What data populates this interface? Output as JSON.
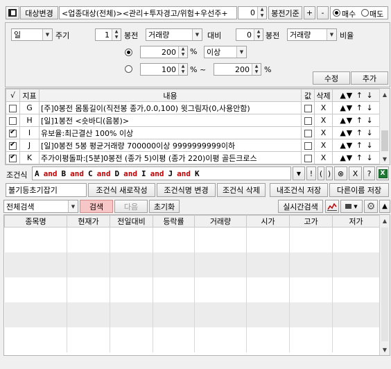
{
  "toolbar": {
    "target_label": "대상변경",
    "target_value": "<업종대상(전체)><관리+투자경고/위험+우선주+",
    "bar_value": "0",
    "bar_basis_label": "봉전기준",
    "plus": "+",
    "minus": "-",
    "buy_label": "매수",
    "sell_label": "매도"
  },
  "settings": {
    "period_value": "일",
    "period_label": "주기",
    "bar1_value": "1",
    "bar1_label": "봉전",
    "metric1_value": "거래량",
    "compare_label": "대비",
    "bar2_value": "0",
    "bar2_label": "봉전",
    "metric2_value": "거래량",
    "ratio_label": "비율",
    "opt1_value": "200",
    "opt1_unit": "%",
    "opt1_cond": "이상",
    "opt2_from": "100",
    "opt2_sep": "% ~",
    "opt2_to": "200",
    "opt2_unit": "%",
    "edit_label": "수정",
    "add_label": "추가"
  },
  "conditions": {
    "headers": {
      "check": "√",
      "index": "지표",
      "content": "내용",
      "value": "값",
      "delete": "삭제"
    },
    "move_labels": {
      "top": "▲",
      "up": "▼",
      "up2": "↑",
      "down": "↓"
    },
    "delete_glyph": "X",
    "rows": [
      {
        "checked": false,
        "index": "G",
        "content": "[주]0봉전 몸통길이(직전봉 종가,0.0,100) 윗그림자(0,사용안함)"
      },
      {
        "checked": false,
        "index": "H",
        "content": "[일]1봉전 <숏바디(음봉)>"
      },
      {
        "checked": true,
        "index": "I",
        "content": "유보율:최근결산 100% 이상"
      },
      {
        "checked": true,
        "index": "J",
        "content": "[일]0봉전 5봉 평균거래량 700000이상 9999999999이하"
      },
      {
        "checked": true,
        "index": "K",
        "content": "주가이평돌파:[5분]0봉전 (종가 5)이평 (종가 220)이평 골든크로스"
      }
    ]
  },
  "formula": {
    "label": "조건식",
    "tokens": [
      "A",
      "and",
      "B",
      "and",
      "C",
      "and",
      "D",
      "and",
      "I",
      "and",
      "J",
      "and",
      "K"
    ],
    "ops": [
      "!",
      "(",
      ")",
      "⊗",
      "X",
      "?"
    ]
  },
  "actions": {
    "stock_open": "불기등초기잡기",
    "new": "조건식 새로작성",
    "rename": "조건식명 변경",
    "delete": "조건식 삭제",
    "my_save": "내조건식 저장",
    "save_as": "다른이름 저장"
  },
  "search": {
    "scope_value": "전체검색",
    "search_label": "검색",
    "next_label": "다음",
    "reset_label": "초기화",
    "realtime_label": "실시간검색"
  },
  "results": {
    "headers": [
      "종목명",
      "현재가",
      "전일대비",
      "등락률",
      "거래량",
      "시가",
      "고가",
      "저가"
    ],
    "rows": []
  },
  "colors": {
    "accent_search": "#f7c7c7",
    "token_op": "#c00000",
    "stripe": "#ececec"
  }
}
